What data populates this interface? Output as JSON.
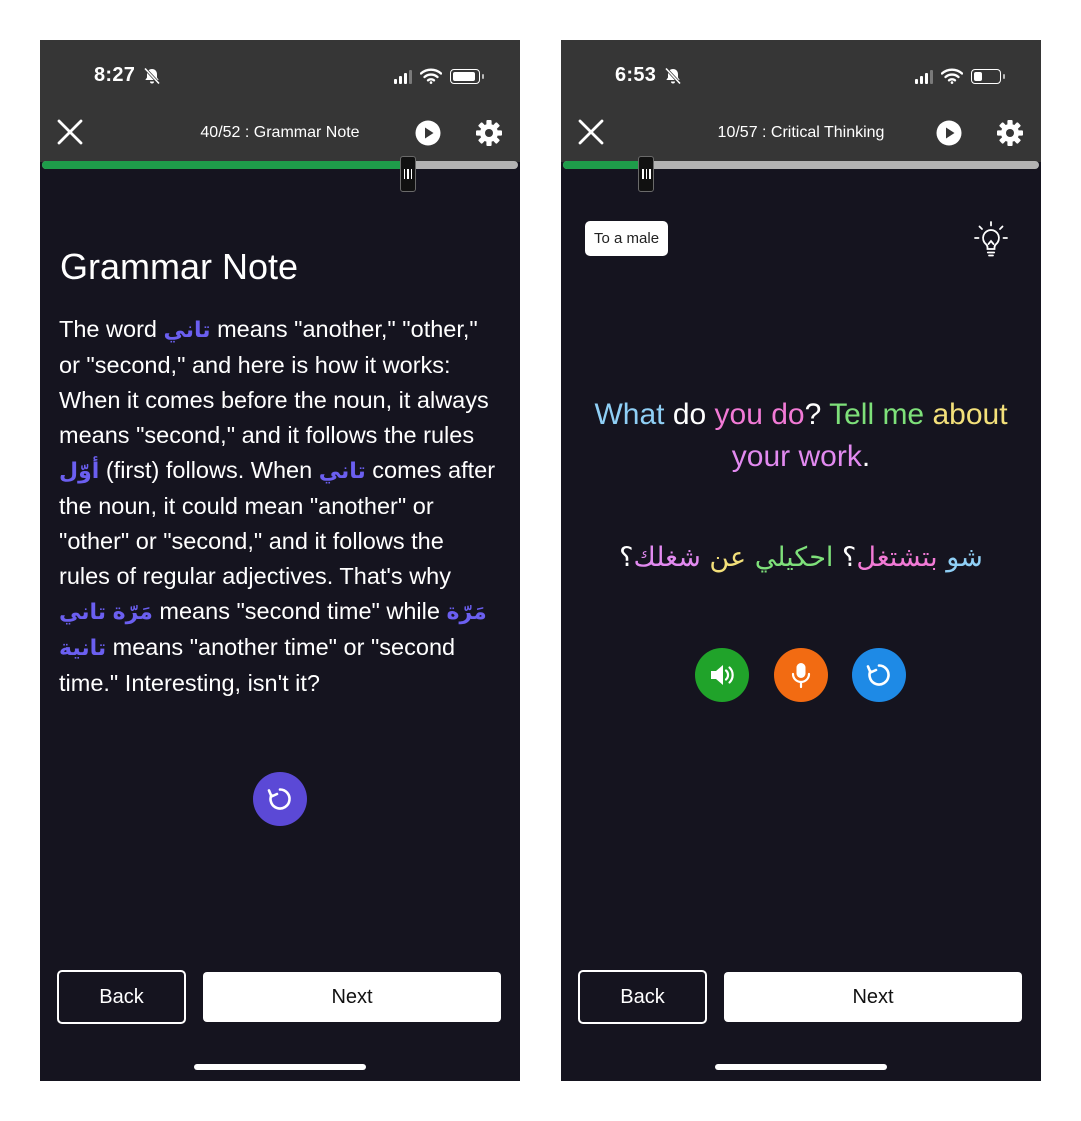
{
  "colors": {
    "screen_bg": "#15141f",
    "topbar_bg": "#363636",
    "progress_fill": "#1e9c4a",
    "progress_track": "#b3b3b3",
    "arabic_accent": "#6b5ff0",
    "replay_purple": "#5b49d6",
    "speaker_green": "#20a32a",
    "mic_orange": "#f26b12",
    "replay_blue": "#1e8ae6"
  },
  "left": {
    "status": {
      "time": "8:27",
      "signal_bars_lit": 3,
      "battery_fraction": 0.95
    },
    "header": {
      "title": "40/52 : Grammar Note",
      "progress_fraction": 0.769
    },
    "content": {
      "title": "Grammar Note",
      "paragraph": [
        {
          "t": "The word "
        },
        {
          "t": "تاني",
          "ar": true
        },
        {
          "t": "  means \"another,\" \"other,\" or \"second,\" and here is how it works: When it comes before the noun, it always means \"second,\" and it follows the rules "
        },
        {
          "t": "أوّل",
          "ar": true
        },
        {
          "t": " (first) follows. When "
        },
        {
          "t": "تاني",
          "ar": true
        },
        {
          "t": " comes after the noun, it could mean \"another\" or \"other\" or \"second,\" and it follows the rules of regular adjectives.  That's why "
        },
        {
          "t": "تاني",
          "ar": true
        },
        {
          "t": " "
        },
        {
          "t": "مَرّة",
          "ar": true
        },
        {
          "t": " means \"second time\" while "
        },
        {
          "t": "مَرّة",
          "ar": true
        },
        {
          "t": " "
        },
        {
          "t": "تانية",
          "ar": true
        },
        {
          "t": " means \"another time\" or \"second time.\"  Interesting, isn't it?"
        }
      ]
    },
    "footer": {
      "back": "Back",
      "next": "Next"
    }
  },
  "right": {
    "status": {
      "time": "6:53",
      "signal_bars_lit": 3,
      "battery_fraction": 0.35
    },
    "header": {
      "title": "10/57 : Critical Thinking",
      "progress_fraction": 0.175
    },
    "content": {
      "chip": "To a male",
      "english": [
        {
          "t": "What",
          "c": "#8fcff5"
        },
        {
          "t": " do ",
          "c": "#ffffff"
        },
        {
          "t": "you do",
          "c": "#f27ad6"
        },
        {
          "t": "? ",
          "c": "#ffffff"
        },
        {
          "t": "Tell me",
          "c": "#7ee07a"
        },
        {
          "t": " about",
          "c": "#f3e07a"
        },
        {
          "t": " ",
          "c": "#ffffff"
        },
        {
          "t": "your work",
          "c": "#e28af0"
        },
        {
          "t": ".",
          "c": "#ffffff"
        }
      ],
      "arabic": [
        {
          "t": "شو",
          "c": "#8fcff5"
        },
        {
          "t": " ",
          "c": "#ffffff"
        },
        {
          "t": "بتشتغل",
          "c": "#f27ad6"
        },
        {
          "t": "؟ ",
          "c": "#ffffff"
        },
        {
          "t": "احكيلي",
          "c": "#7ee07a"
        },
        {
          "t": " ",
          "c": "#ffffff"
        },
        {
          "t": "عن",
          "c": "#f3e07a"
        },
        {
          "t": " ",
          "c": "#ffffff"
        },
        {
          "t": "شغلك",
          "c": "#e28af0"
        },
        {
          "t": "؟",
          "c": "#ffffff"
        }
      ]
    },
    "footer": {
      "back": "Back",
      "next": "Next"
    }
  }
}
